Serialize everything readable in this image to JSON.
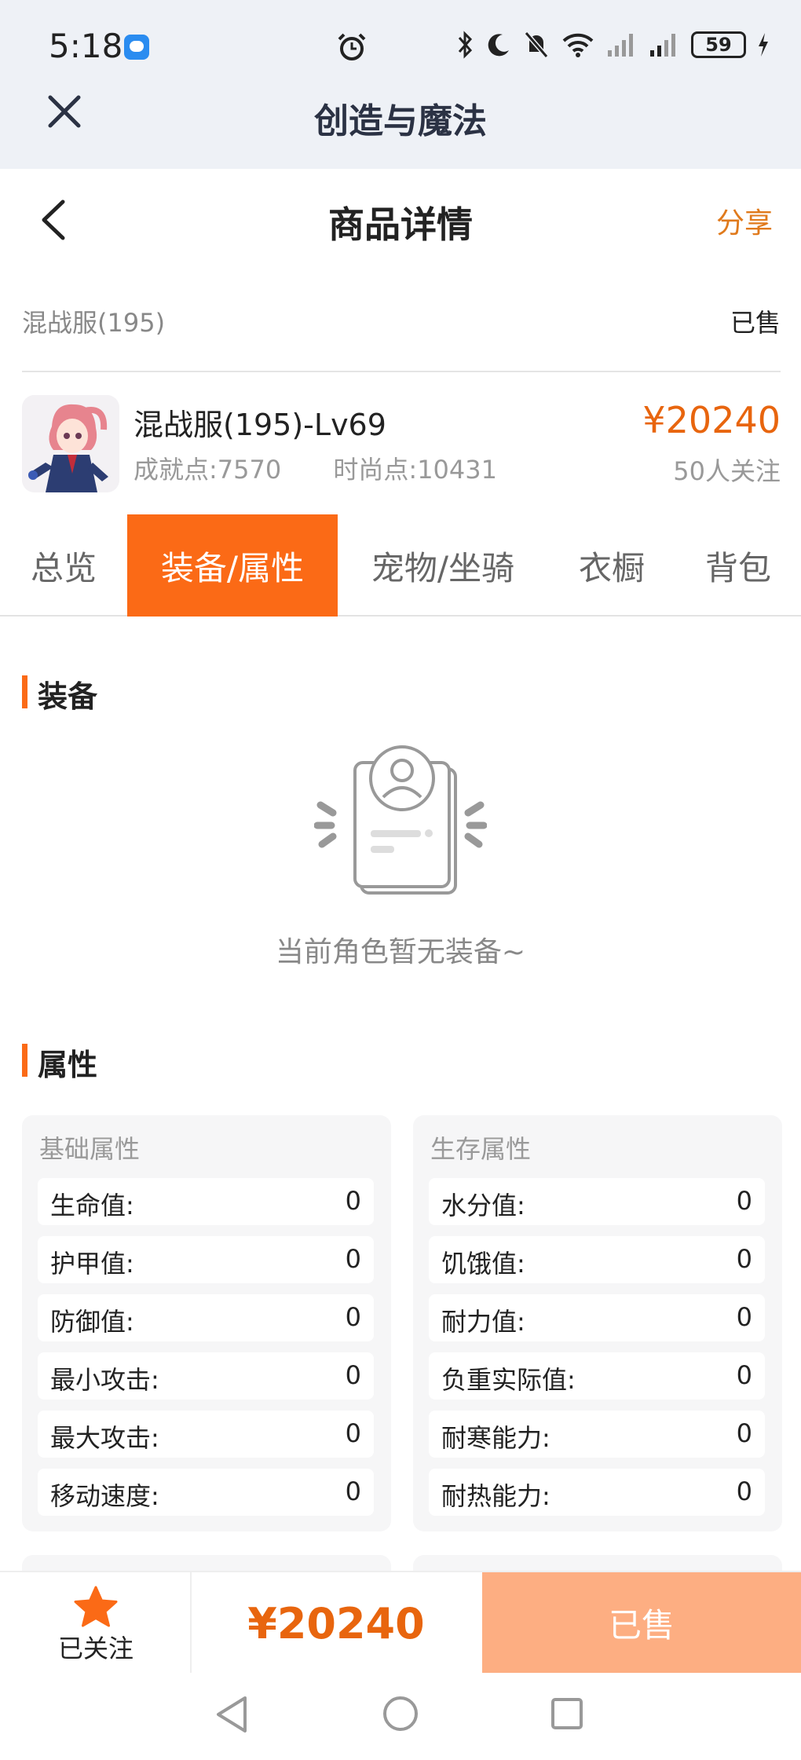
{
  "status_bar": {
    "time": "5:18",
    "battery": "59"
  },
  "app": {
    "title": "创造与魔法"
  },
  "nav": {
    "title": "商品详情",
    "share": "分享"
  },
  "server": {
    "name": "混战服(195)",
    "status": "已售"
  },
  "product": {
    "title": "混战服(195)-Lv69",
    "achievement": "成就点:7570",
    "fashion": "时尚点:10431",
    "price": "¥20240",
    "followers": "50人关注"
  },
  "tabs": [
    {
      "label": "总览",
      "active": false
    },
    {
      "label": "装备/属性",
      "active": true
    },
    {
      "label": "宠物/坐骑",
      "active": false
    },
    {
      "label": "衣橱",
      "active": false
    },
    {
      "label": "背包",
      "active": false
    }
  ],
  "equipment": {
    "heading": "装备",
    "empty_text": "当前角色暂无装备~"
  },
  "attributes": {
    "heading": "属性",
    "basic": {
      "title": "基础属性",
      "rows": [
        {
          "label": "生命值:",
          "value": "0"
        },
        {
          "label": "护甲值:",
          "value": "0"
        },
        {
          "label": "防御值:",
          "value": "0"
        },
        {
          "label": "最小攻击:",
          "value": "0"
        },
        {
          "label": "最大攻击:",
          "value": "0"
        },
        {
          "label": "移动速度:",
          "value": "0"
        }
      ]
    },
    "survival": {
      "title": "生存属性",
      "rows": [
        {
          "label": "水分值:",
          "value": "0"
        },
        {
          "label": "饥饿值:",
          "value": "0"
        },
        {
          "label": "耐力值:",
          "value": "0"
        },
        {
          "label": "负重实际值:",
          "value": "0"
        },
        {
          "label": "耐寒能力:",
          "value": "0"
        },
        {
          "label": "耐热能力:",
          "value": "0"
        }
      ]
    }
  },
  "bottom": {
    "follow_label": "已关注",
    "price": "¥20240",
    "sold_button": "已售"
  },
  "colors": {
    "accent": "#fb6a16",
    "price": "#e8650e",
    "sold_button": "#fdae82"
  }
}
